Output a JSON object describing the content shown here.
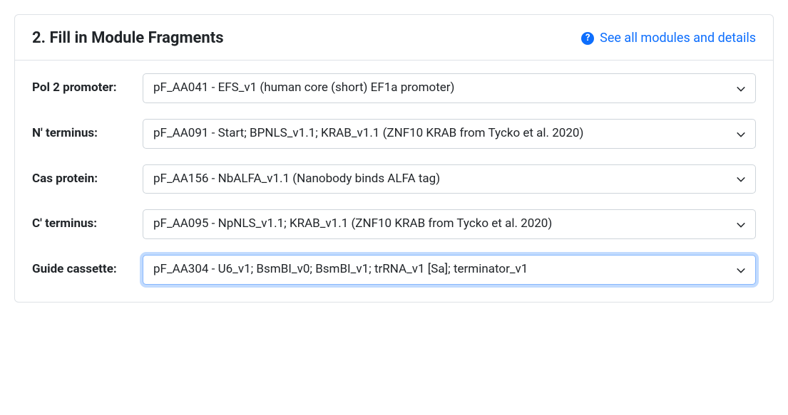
{
  "header": {
    "title": "2. Fill in Module Fragments",
    "help_link": "See all modules and details"
  },
  "fields": [
    {
      "label": "Pol 2 promoter:",
      "value": "pF_AA041 - EFS_v1 (human core (short) EF1a promoter)",
      "focused": false
    },
    {
      "label": "N' terminus:",
      "value": "pF_AA091 - Start; BPNLS_v1.1; KRAB_v1.1 (ZNF10 KRAB from Tycko et al. 2020)",
      "focused": false
    },
    {
      "label": "Cas protein:",
      "value": "pF_AA156 - NbALFA_v1.1 (Nanobody binds ALFA tag)",
      "focused": false
    },
    {
      "label": "C' terminus:",
      "value": "pF_AA095 - NpNLS_v1.1; KRAB_v1.1 (ZNF10 KRAB from Tycko et al. 2020)",
      "focused": false
    },
    {
      "label": "Guide cassette:",
      "value": "pF_AA304 - U6_v1; BsmBI_v0; BsmBI_v1; trRNA_v1 [Sa]; terminator_v1",
      "focused": true
    }
  ]
}
